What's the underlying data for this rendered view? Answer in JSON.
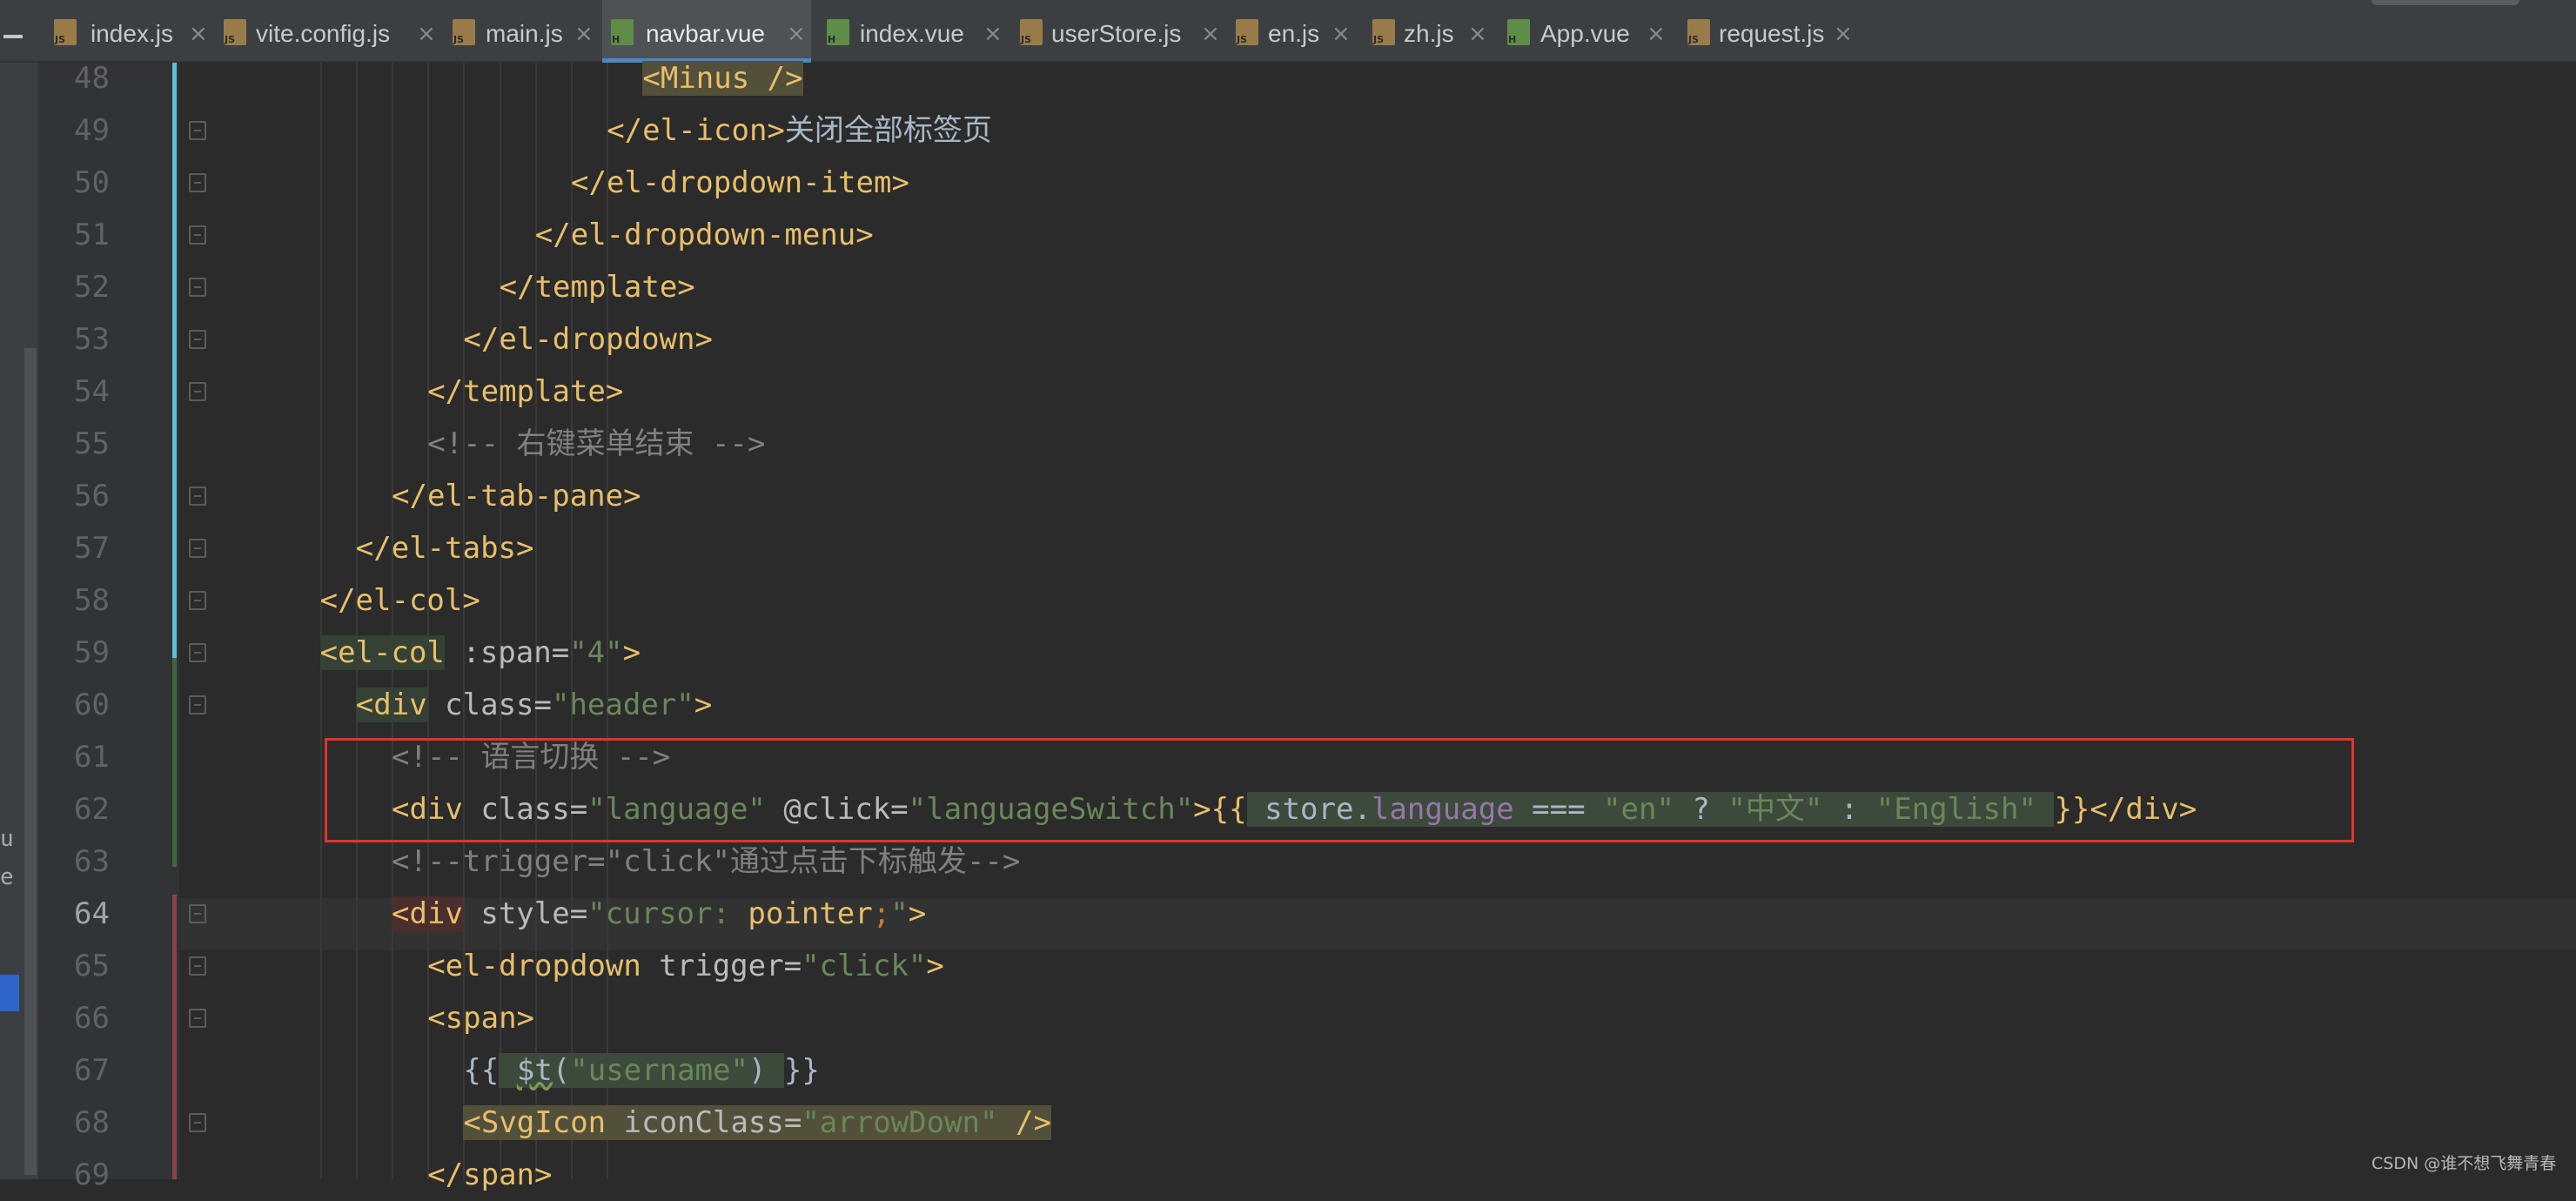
{
  "tabs": [
    {
      "name": "index.js",
      "type": "JS",
      "active": false
    },
    {
      "name": "vite.config.js",
      "type": "JS",
      "active": false
    },
    {
      "name": "main.js",
      "type": "JS",
      "active": false
    },
    {
      "name": "navbar.vue",
      "type": "H",
      "active": true
    },
    {
      "name": "index.vue",
      "type": "H",
      "active": false
    },
    {
      "name": "userStore.js",
      "type": "JS",
      "active": false
    },
    {
      "name": "en.js",
      "type": "JS",
      "active": false
    },
    {
      "name": "zh.js",
      "type": "JS",
      "active": false
    },
    {
      "name": "App.vue",
      "type": "H",
      "active": false
    },
    {
      "name": "request.js",
      "type": "JS",
      "active": false
    }
  ],
  "tab_close_glyph": "×",
  "side_fragments": [
    "u",
    "e"
  ],
  "current_line": 64,
  "lines": [
    {
      "num": "48",
      "tokens": [
        {
          "text": "<Minus />",
          "c": "tag hl-y"
        }
      ]
    },
    {
      "num": "49",
      "tokens": [
        {
          "text": "</el-icon>",
          "c": "tag"
        },
        {
          "text": "关闭全部标签页",
          "c": "txt zh"
        }
      ]
    },
    {
      "num": "50",
      "tokens": [
        {
          "text": "</el-dropdown-item>",
          "c": "tag"
        }
      ]
    },
    {
      "num": "51",
      "tokens": [
        {
          "text": "</el-dropdown-menu>",
          "c": "tag"
        }
      ]
    },
    {
      "num": "52",
      "tokens": [
        {
          "text": "</template>",
          "c": "tag"
        }
      ]
    },
    {
      "num": "53",
      "tokens": [
        {
          "text": "</el-dropdown>",
          "c": "tag"
        }
      ]
    },
    {
      "num": "54",
      "tokens": [
        {
          "text": "</template>",
          "c": "tag"
        }
      ]
    },
    {
      "num": "55",
      "tokens": [
        {
          "text": "<!-- ",
          "c": "cmt"
        },
        {
          "text": "右键菜单结束",
          "c": "cmt zh"
        },
        {
          "text": " -->",
          "c": "cmt"
        }
      ]
    },
    {
      "num": "56",
      "tokens": [
        {
          "text": "</el-tab-pane>",
          "c": "tag"
        }
      ]
    },
    {
      "num": "57",
      "tokens": [
        {
          "text": "</el-tabs>",
          "c": "tag"
        }
      ]
    },
    {
      "num": "58",
      "tokens": [
        {
          "text": "</el-col>",
          "c": "tag"
        }
      ]
    },
    {
      "num": "59",
      "tokens": [
        {
          "text": "<el-col",
          "c": "tag hl-g"
        },
        {
          "text": " :span=",
          "c": "attr"
        },
        {
          "text": "\"4\"",
          "c": "val"
        },
        {
          "text": ">",
          "c": "tag"
        }
      ]
    },
    {
      "num": "60",
      "tokens": [
        {
          "text": "<div",
          "c": "tag hl-g"
        },
        {
          "text": " class=",
          "c": "attr"
        },
        {
          "text": "\"header\"",
          "c": "val"
        },
        {
          "text": ">",
          "c": "tag"
        }
      ]
    },
    {
      "num": "61",
      "tokens": [
        {
          "text": "<!-- ",
          "c": "cmt"
        },
        {
          "text": "语言切换",
          "c": "cmt zh"
        },
        {
          "text": " -->",
          "c": "cmt"
        }
      ]
    },
    {
      "num": "62",
      "tokens": [
        {
          "text": "<div",
          "c": "tag"
        },
        {
          "text": " class=",
          "c": "attr"
        },
        {
          "text": "\"language\"",
          "c": "val"
        },
        {
          "text": " @click=",
          "c": "attr"
        },
        {
          "text": "\"languageSwitch\"",
          "c": "val"
        },
        {
          "text": ">{{",
          "c": "tag"
        },
        {
          "text": " store",
          "c": "txt hl-expr"
        },
        {
          "text": ".",
          "c": "txt hl-expr"
        },
        {
          "text": "language",
          "c": "prop hl-expr"
        },
        {
          "text": " === ",
          "c": "op hl-expr"
        },
        {
          "text": "\"en\"",
          "c": "val hl-expr"
        },
        {
          "text": " ? ",
          "c": "op hl-expr"
        },
        {
          "text": "\"",
          "c": "val hl-expr"
        },
        {
          "text": "中文",
          "c": "val zh hl-expr"
        },
        {
          "text": "\"",
          "c": "val hl-expr"
        },
        {
          "text": " : ",
          "c": "op hl-expr"
        },
        {
          "text": "\"English\" ",
          "c": "val hl-expr"
        },
        {
          "text": "}}</div>",
          "c": "tag"
        }
      ]
    },
    {
      "num": "63",
      "tokens": [
        {
          "text": "<!--trigger=\"click\"",
          "c": "cmt"
        },
        {
          "text": "通过点击下标触发",
          "c": "cmt zh"
        },
        {
          "text": "-->",
          "c": "cmt"
        }
      ]
    },
    {
      "num": "64",
      "tokens": [
        {
          "text": "<div",
          "c": "tag hl-r"
        },
        {
          "text": " style=",
          "c": "attr"
        },
        {
          "text": "\"cursor: ",
          "c": "val"
        },
        {
          "text": "pointer",
          "c": "tag"
        },
        {
          "text": ";",
          "c": "semi"
        },
        {
          "text": "\"",
          "c": "val"
        },
        {
          "text": ">",
          "c": "tag"
        }
      ]
    },
    {
      "num": "65",
      "tokens": [
        {
          "text": "<el-dropdown",
          "c": "tag"
        },
        {
          "text": " trigger=",
          "c": "attr"
        },
        {
          "text": "\"click\"",
          "c": "val"
        },
        {
          "text": ">",
          "c": "tag"
        }
      ]
    },
    {
      "num": "66",
      "tokens": [
        {
          "text": "<span>",
          "c": "tag"
        }
      ]
    },
    {
      "num": "67",
      "tokens": [
        {
          "text": "{{",
          "c": "txt"
        },
        {
          "text": " ",
          "c": "txt hl-expr"
        },
        {
          "text": "$t",
          "c": "txt hl-expr undl"
        },
        {
          "text": "(",
          "c": "txt hl-expr"
        },
        {
          "text": "\"username\"",
          "c": "val hl-expr"
        },
        {
          "text": ") ",
          "c": "txt hl-expr"
        },
        {
          "text": "}}",
          "c": "txt"
        }
      ]
    },
    {
      "num": "68",
      "tokens": [
        {
          "text": "<SvgIcon",
          "c": "tag hl-y"
        },
        {
          "text": " iconClass=",
          "c": "attr hl-y"
        },
        {
          "text": "\"arrowDown\"",
          "c": "val hl-y"
        },
        {
          "text": " />",
          "c": "tag hl-y"
        }
      ]
    },
    {
      "num": "69",
      "tokens": [
        {
          "text": "</span>",
          "c": "tag"
        }
      ]
    }
  ],
  "watermark": "CSDN @谁不想飞舞青春"
}
